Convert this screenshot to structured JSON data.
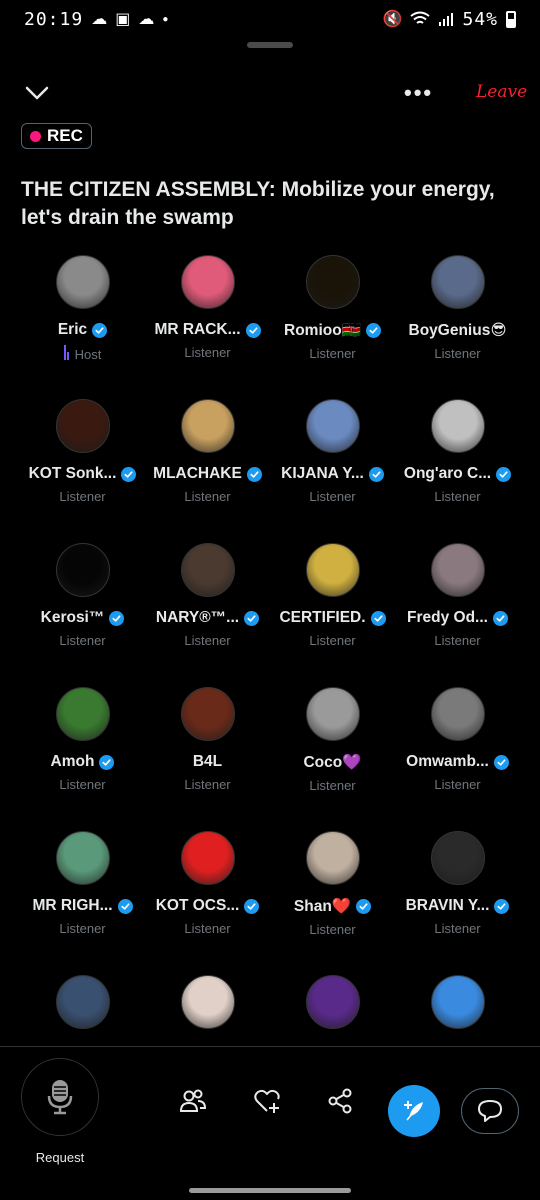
{
  "status": {
    "time": "20:19",
    "battery": "54%",
    "left_icons": [
      "cloud-icon",
      "image-icon",
      "cloud-icon",
      "dot-icon"
    ],
    "right_icons": [
      "mute-icon",
      "wifi-icon",
      "signal-icon",
      "battery-icon"
    ]
  },
  "header": {
    "leave_label": "Leave",
    "more_icon": "more-icon",
    "collapse_icon": "chevron-down-icon"
  },
  "rec": {
    "label": "REC",
    "color": "#f91880"
  },
  "space": {
    "title": "THE CITIZEN ASSEMBLY: Mobilize your energy, let's drain the swamp"
  },
  "participants": [
    {
      "name": "Eric",
      "role": "Host",
      "verified": true,
      "avatar": "#8a8a8a"
    },
    {
      "name": "MR RACK...",
      "role": "Listener",
      "verified": true,
      "avatar": "#e05a7a"
    },
    {
      "name": "Romioo🇰🇪",
      "role": "Listener",
      "verified": true,
      "avatar": "#1a1408"
    },
    {
      "name": "BoyGenius😎",
      "role": "Listener",
      "verified": false,
      "avatar": "#5a6a8a"
    },
    {
      "name": "KOT Sonk...",
      "role": "Listener",
      "verified": true,
      "avatar": "#3a1a10"
    },
    {
      "name": "MLACHAKE",
      "role": "Listener",
      "verified": true,
      "avatar": "#c8a060"
    },
    {
      "name": "KIJANA Y...",
      "role": "Listener",
      "verified": true,
      "avatar": "#6a8ac0"
    },
    {
      "name": "Ong'aro C...",
      "role": "Listener",
      "verified": true,
      "avatar": "#c0c0c0"
    },
    {
      "name": "Kerosi™",
      "role": "Listener",
      "verified": true,
      "avatar": "#050505"
    },
    {
      "name": "NARY®™...",
      "role": "Listener",
      "verified": true,
      "avatar": "#4a3a30"
    },
    {
      "name": "CERTIFIED.",
      "role": "Listener",
      "verified": true,
      "avatar": "#d0b040"
    },
    {
      "name": "Fredy Od...",
      "role": "Listener",
      "verified": true,
      "avatar": "#8a7a80"
    },
    {
      "name": "Amoh",
      "role": "Listener",
      "verified": true,
      "avatar": "#3a7a30"
    },
    {
      "name": "B4L",
      "role": "Listener",
      "verified": false,
      "avatar": "#6a2a1a"
    },
    {
      "name": "Coco💜",
      "role": "Listener",
      "verified": false,
      "avatar": "#9a9a9a"
    },
    {
      "name": "Omwamb...",
      "role": "Listener",
      "verified": true,
      "avatar": "#7a7a7a"
    },
    {
      "name": "MR RIGH...",
      "role": "Listener",
      "verified": true,
      "avatar": "#5a9a7a"
    },
    {
      "name": "KOT OCS...",
      "role": "Listener",
      "verified": true,
      "avatar": "#e02020"
    },
    {
      "name": "Shan❤️",
      "role": "Listener",
      "verified": true,
      "avatar": "#c0b0a0"
    },
    {
      "name": "BRAVIN Y...",
      "role": "Listener",
      "verified": true,
      "avatar": "#2a2a2a"
    },
    {
      "avatar": "#3a5070"
    },
    {
      "avatar": "#e0d0c8"
    },
    {
      "avatar": "#5a2a8a"
    },
    {
      "avatar": "#3a8ae0"
    }
  ],
  "bottom": {
    "request_label": "Request",
    "icons": [
      "people-icon",
      "heart-plus-icon",
      "share-icon",
      "compose-icon",
      "chat-icon"
    ],
    "accent": "#1d9bf0"
  }
}
